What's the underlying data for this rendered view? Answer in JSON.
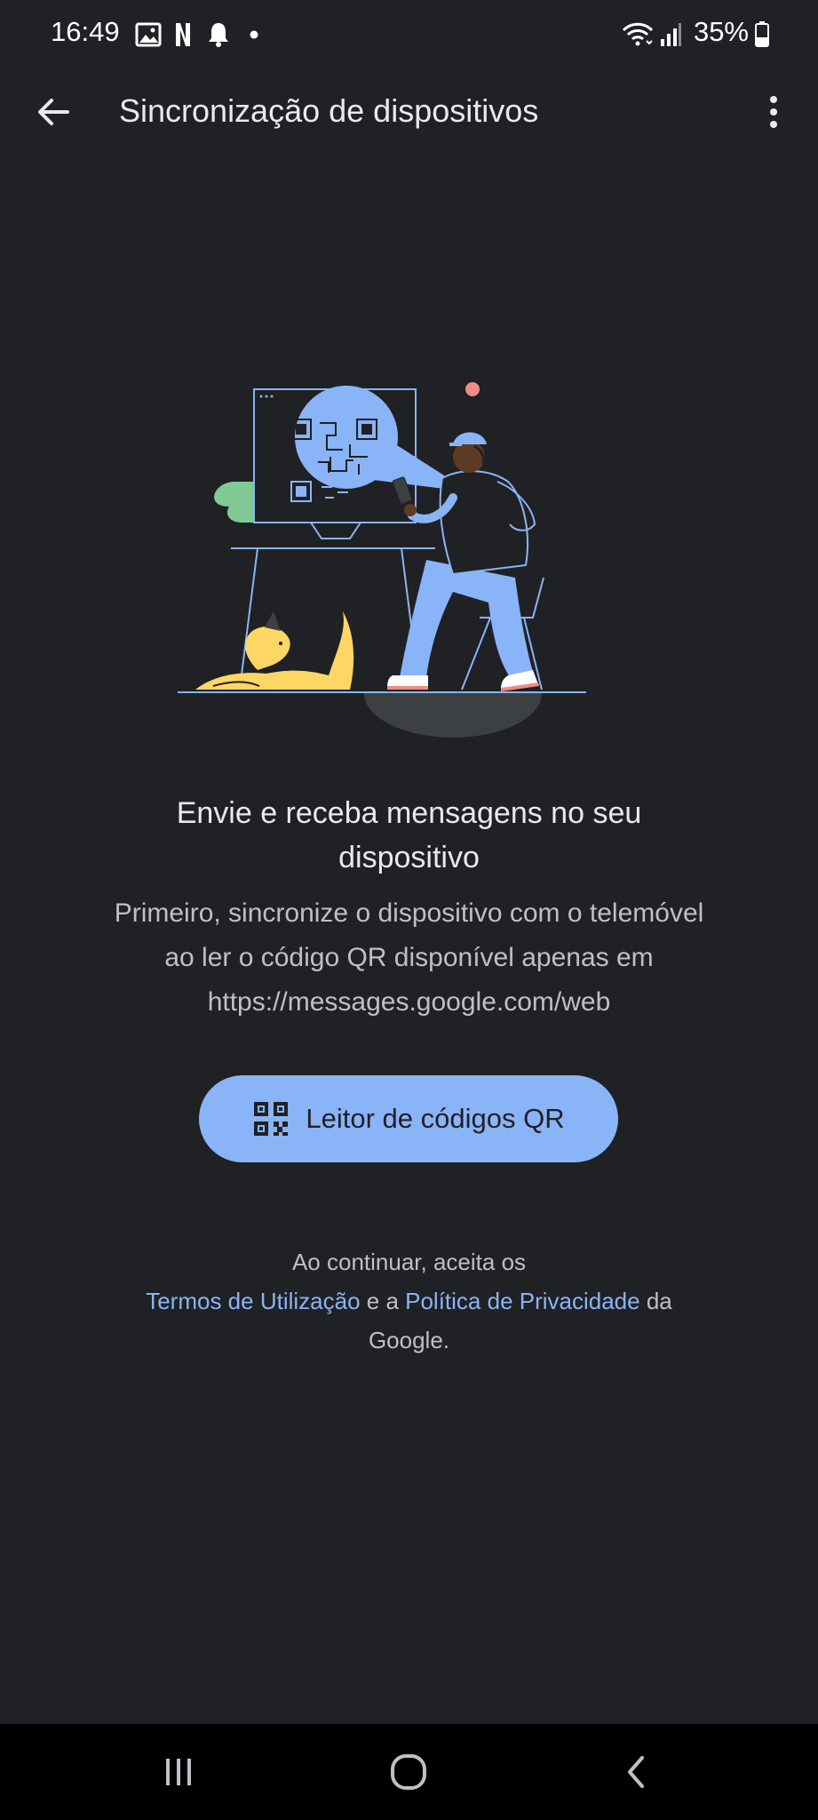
{
  "status_bar": {
    "time": "16:49",
    "battery": "35%",
    "icons": [
      "image-icon",
      "netflix-icon",
      "bell-icon",
      "dot-icon",
      "wifi-icon",
      "signal-icon",
      "battery-icon"
    ]
  },
  "app_bar": {
    "title": "Sincronização de dispositivos",
    "back_icon": "arrow-back-icon",
    "more_icon": "more-vert-icon"
  },
  "content": {
    "heading_line1": "Envie e receba mensagens no seu",
    "heading_line2": "dispositivo",
    "description_line1": "Primeiro, sincronize o dispositivo com o telemóvel",
    "description_line2": "ao ler o código QR disponível apenas em",
    "description_line3": "https://messages.google.com/web",
    "qr_button_label": "Leitor de códigos QR",
    "qr_button_icon": "qr-code-icon"
  },
  "legal": {
    "line1": "Ao continuar, aceita os",
    "terms_link": "Termos de Utilização",
    "and_text": " e a ",
    "privacy_link": "Política de Privacidade",
    "suffix": " da",
    "line3": "Google."
  },
  "nav_bar": {
    "icons": [
      "recents-icon",
      "home-icon",
      "back-icon"
    ]
  },
  "colors": {
    "background": "#202124",
    "accent": "#8ab4f8",
    "text_primary": "#e8eaed",
    "text_secondary": "#bdc1c6",
    "nav_background": "#000000"
  }
}
